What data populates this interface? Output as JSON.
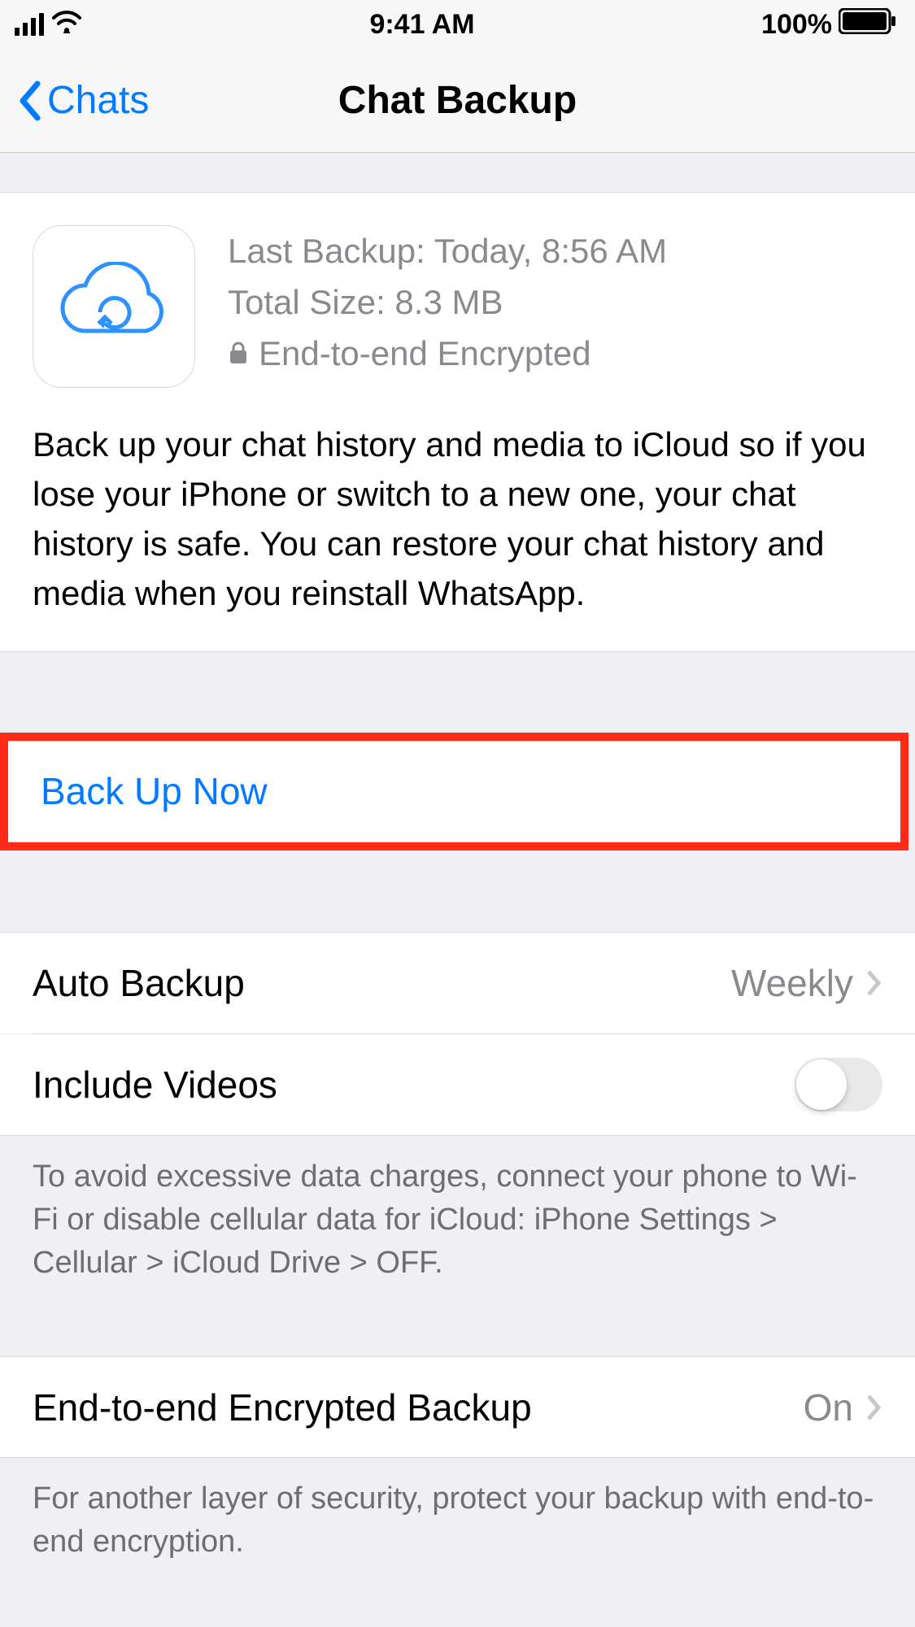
{
  "status": {
    "time": "9:41 AM",
    "battery": "100%"
  },
  "nav": {
    "back_label": "Chats",
    "title": "Chat Backup"
  },
  "info": {
    "last_backup_label": "Last Backup: Today, 8:56 AM",
    "total_size_label": "Total Size: 8.3 MB",
    "encrypted_label": "End-to-end Encrypted",
    "description": "Back up your chat history and media to iCloud so if you lose your iPhone or switch to a new one, your chat history is safe. You can restore your chat history and media when you reinstall WhatsApp."
  },
  "actions": {
    "backup_now_label": "Back Up Now"
  },
  "settings": {
    "auto_backup_label": "Auto Backup",
    "auto_backup_value": "Weekly",
    "include_videos_label": "Include Videos",
    "include_videos_on": false,
    "data_note": "To avoid excessive data charges, connect your phone to Wi-Fi or disable cellular data for iCloud: iPhone Settings > Cellular > iCloud Drive > OFF.",
    "e2e_label": "End-to-end Encrypted Backup",
    "e2e_value": "On",
    "e2e_note": "For another layer of security, protect your backup with end-to-end encryption."
  },
  "highlight": {
    "target": "backup-now-button"
  }
}
